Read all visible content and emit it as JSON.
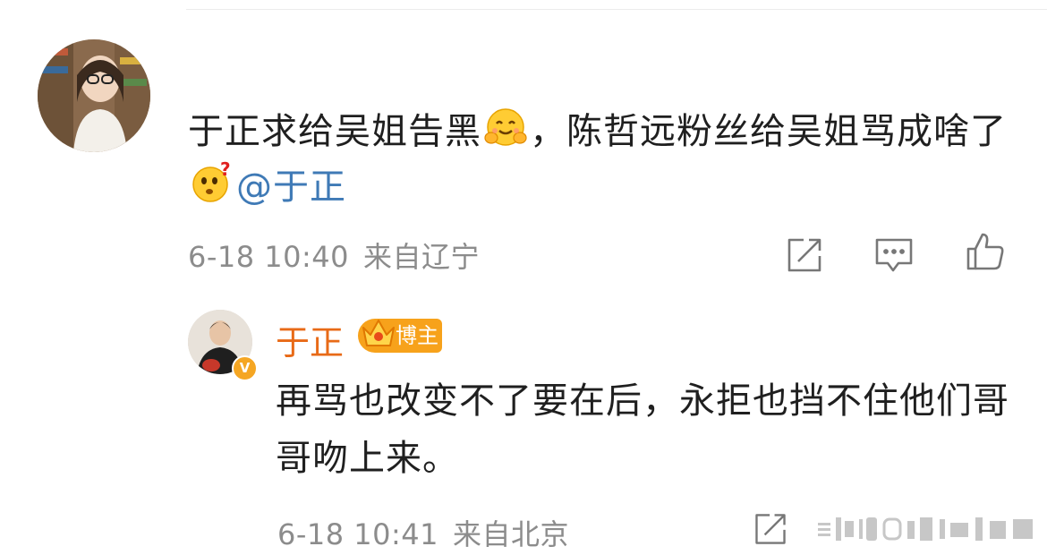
{
  "comment": {
    "text_part1": "于正求给吴姐告黑",
    "text_part2": "，陈哲远粉丝给吴姐骂成啥了",
    "mention": "@于正",
    "emoji_1": "blush-hands-emoji",
    "emoji_2": "confused-question-emoji",
    "timestamp": "6-18 10:40",
    "location": "来自辽宁",
    "actions": [
      "share-icon",
      "comment-icon",
      "like-icon"
    ]
  },
  "reply": {
    "author": "于正",
    "badge": "博主",
    "text": "再骂也改变不了要在后，永拒也挡不住他们哥哥吻上来。",
    "timestamp": "6-18 10:41",
    "location": "来自北京",
    "verified_icon": "verified-v-icon",
    "actions": [
      "share-icon"
    ]
  },
  "colors": {
    "author_name": "#e86a17",
    "badge_bg": "#f7a21b",
    "mention": "#3f7ab6",
    "meta_gray": "#8c8c8c"
  }
}
